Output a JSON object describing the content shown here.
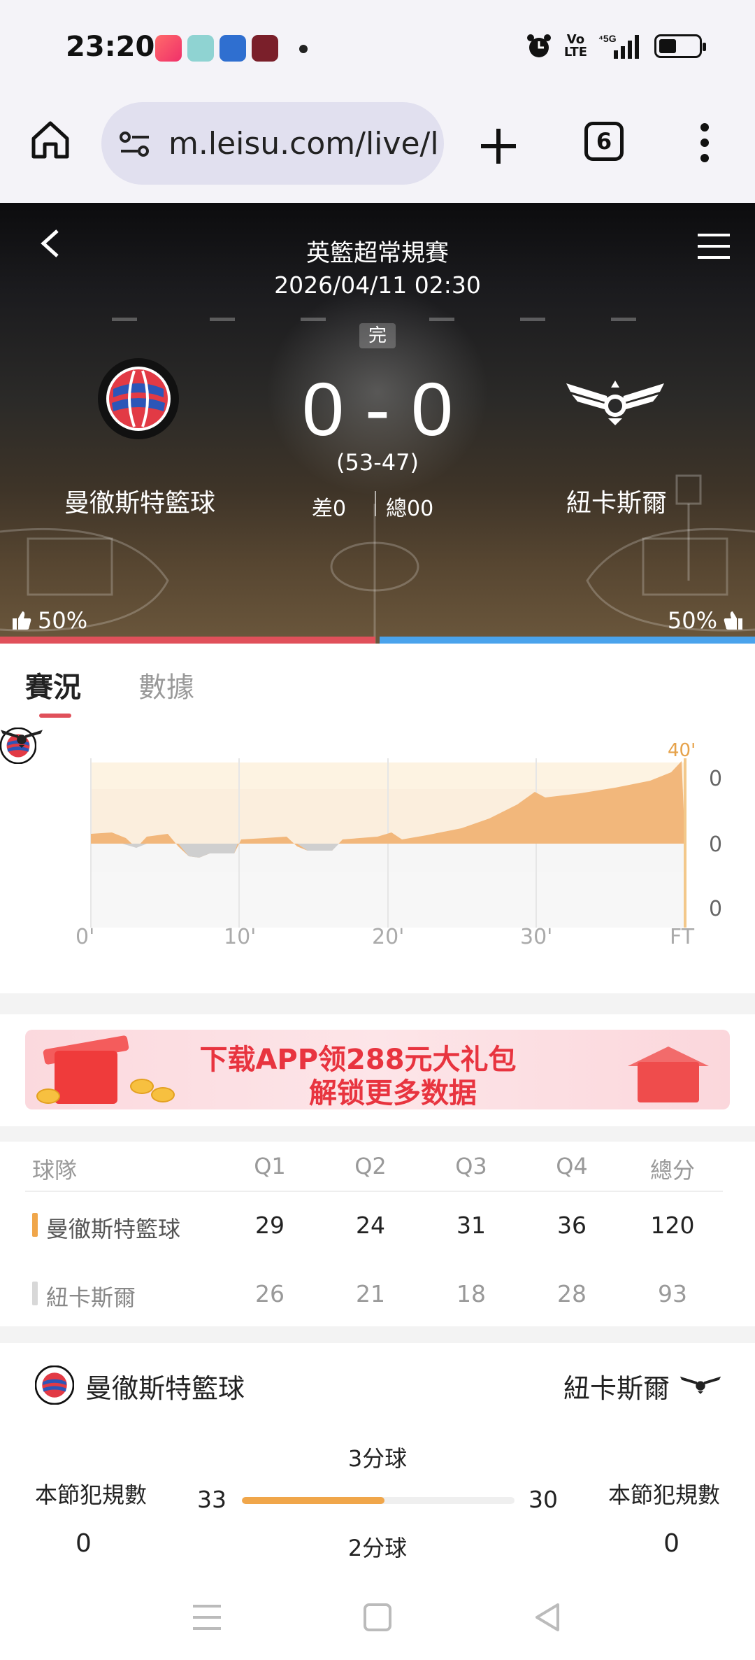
{
  "status_bar": {
    "time": "23:20",
    "apps": [
      "app-icon-red",
      "app-icon-bear",
      "app-icon-blue",
      "app-icon-maroon"
    ],
    "volte": [
      "Vo",
      "LTE"
    ],
    "network": "5G"
  },
  "browser": {
    "url": "m.leisu.com/live/l",
    "tab_count": "6"
  },
  "match": {
    "league": "英籃超常規賽",
    "datetime": "2026/04/11 02:30",
    "status": "完",
    "score": "0 - 0",
    "half_score": "(53-47)",
    "home_team": "曼徹斯特籃球",
    "away_team": "紐卡斯爾",
    "diff": "差0",
    "total": "總00",
    "home_vote": "50%",
    "away_vote": "50%",
    "home_vote_fraction": 0.5
  },
  "tabs": {
    "active": "賽況",
    "inactive": "數據"
  },
  "trend": {
    "x_labels": [
      "0'",
      "10'",
      "20'",
      "30'",
      "FT"
    ],
    "y_labels": [
      "0",
      "0",
      "0"
    ],
    "end_label": "40'"
  },
  "banner": {
    "line1": "下载APP领288元大礼包",
    "line2": "解锁更多数据"
  },
  "quarters": {
    "headers": [
      "球隊",
      "Q1",
      "Q2",
      "Q3",
      "Q4",
      "總分"
    ],
    "rows": [
      {
        "team": "曼徹斯特籃球",
        "scores": [
          "29",
          "24",
          "31",
          "36",
          "120"
        ],
        "color": "#f0a64a"
      },
      {
        "team": "紐卡斯爾",
        "scores": [
          "26",
          "21",
          "18",
          "28",
          "93"
        ],
        "color": "#d8d8d8"
      }
    ]
  },
  "stats": {
    "home_name": "曼徹斯特籃球",
    "away_name": "紐卡斯爾",
    "foul_label": "本節犯規數",
    "home_fouls": "0",
    "away_fouls": "0",
    "three_pt_label": "3分球",
    "three_pt_home": "33",
    "three_pt_away": "30",
    "three_pt_home_share": 0.524,
    "two_pt_label": "2分球"
  },
  "colors": {
    "accent_red": "#e0505a",
    "accent_blue": "#4aa3ec",
    "accent_orange": "#f0a64a"
  }
}
